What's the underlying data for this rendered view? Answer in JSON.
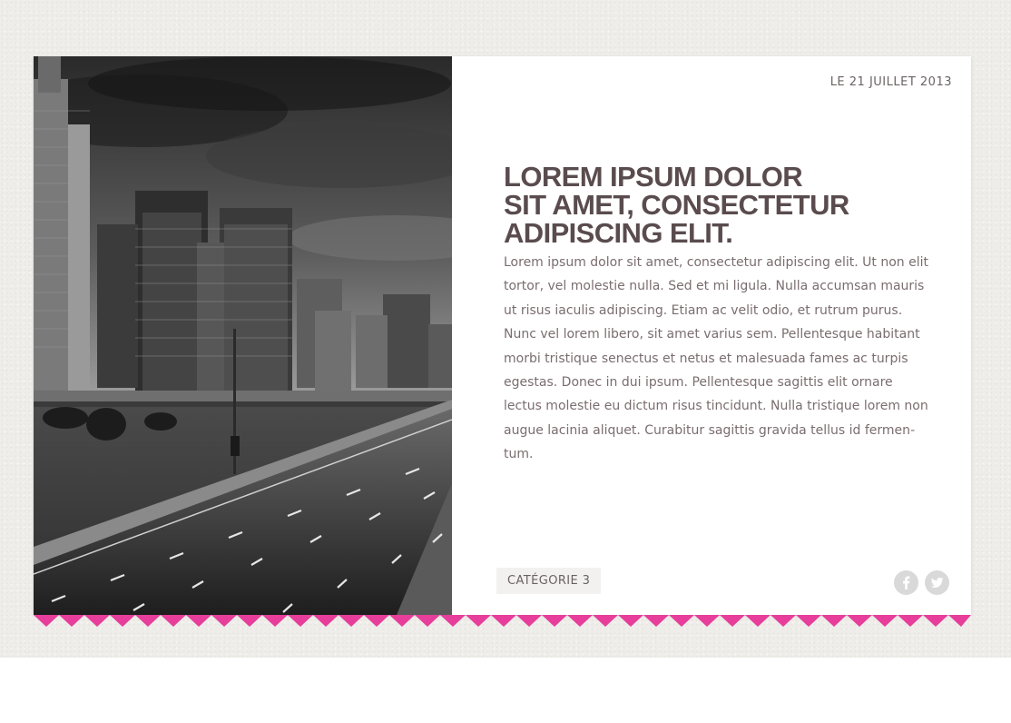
{
  "article": {
    "date": "LE 21 JUILLET 2013",
    "title_lines": [
      "LOREM IPSUM DOLOR",
      "SIT AMET, CONSECTETUR",
      "ADIPISCING ELIT."
    ],
    "body": "Lorem ipsum dolor sit amet, consectetur adipiscing elit. Ut non elit tortor, vel molestie nulla. Sed et mi ligula. Nulla accumsan mauris ut risus iaculis adipiscing. Etiam ac velit odio, et rutrum purus. Nunc vel lorem libero, sit amet varius sem. Pellentesque habitant morbi tristique senectus et netus et malesuada fames ac turpis egestas. Donec in dui ipsum. Pellentesque sagittis elit ornare lectus molestie eu dictum risus tincidunt. Nulla tristique lorem non augue lacinia aliquet. Curabitur sagittis gravida tellus id fermen­tum.",
    "category": "CATÉGORIE 3"
  },
  "photo": {
    "subject": "black-and-white city skyline with empty highway"
  },
  "social": {
    "facebook_icon": "facebook-icon",
    "twitter_icon": "twitter-icon"
  },
  "colors": {
    "background": "#eeede9",
    "card": "#ffffff",
    "title": "#5a4c4e",
    "text": "#7a6d6f",
    "accent": "#e63e9a",
    "category_bg": "#f2f1ef",
    "social_bg": "#d9d9d9"
  }
}
